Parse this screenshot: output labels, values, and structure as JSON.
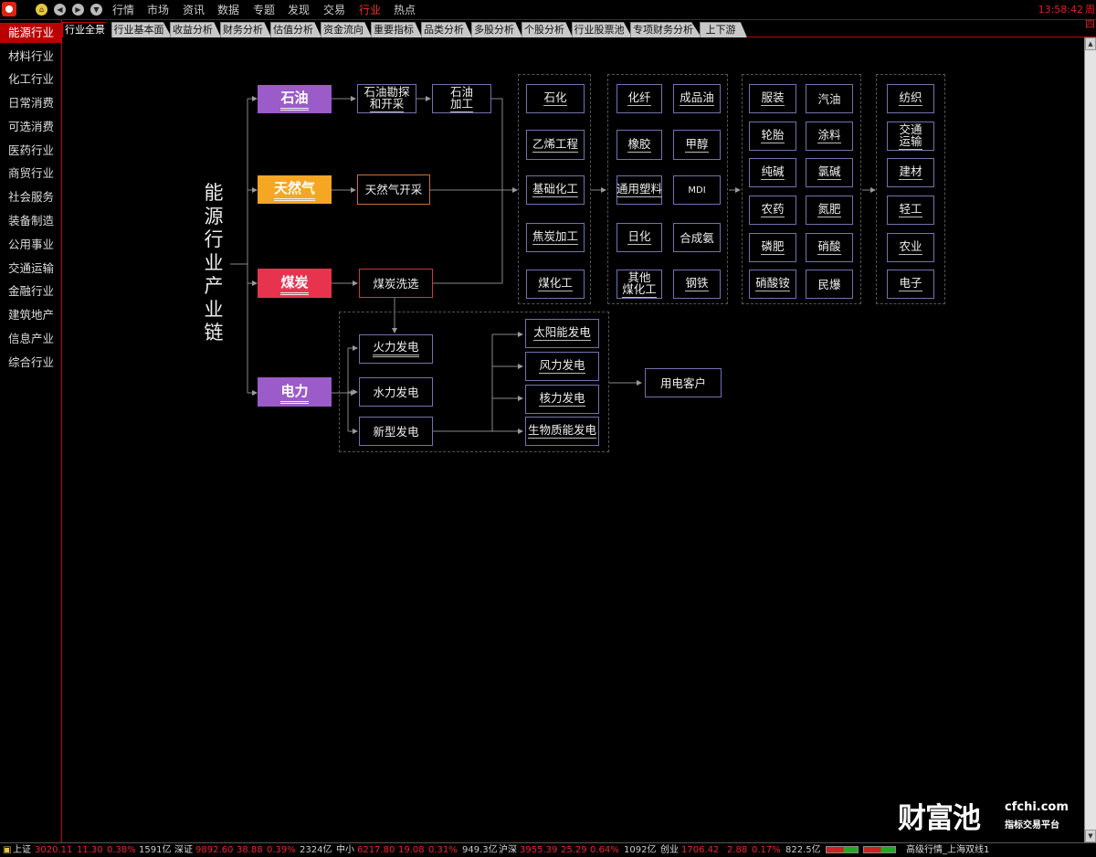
{
  "topbar": {
    "menu": [
      "行情",
      "市场",
      "资讯",
      "数据",
      "专题",
      "发现",
      "交易",
      "行业",
      "热点"
    ],
    "active_menu": "行业",
    "clock": "13:58:42",
    "clock_tail": "周四"
  },
  "tabs": [
    "行业全景",
    "行业基本面",
    "收益分析",
    "财务分析",
    "估值分析",
    "资金流向",
    "重要指标",
    "品类分析",
    "多股分析",
    "个股分析",
    "行业股票池",
    "专项财务分析",
    "上下游"
  ],
  "active_tab": "行业全景",
  "sidebar": {
    "items": [
      "能源行业",
      "材料行业",
      "化工行业",
      "日常消费",
      "可选消费",
      "医药行业",
      "商贸行业",
      "社会服务",
      "装备制造",
      "公用事业",
      "交通运输",
      "金融行业",
      "建筑地产",
      "信息产业",
      "综合行业"
    ],
    "active": "能源行业"
  },
  "diagram": {
    "title": "能源行业产业链",
    "sources": {
      "oil": "石油",
      "gas": "天然气",
      "coal": "煤炭",
      "power": "电力"
    },
    "mid": {
      "oil_explore": "石油勘探和开采",
      "oil_explore_l1": "石油勘探",
      "oil_explore_l2": "和开采",
      "oil_process_l1": "石油",
      "oil_process_l2": "加工",
      "gas_mining": "天然气开采",
      "coal_wash": "煤炭洗选"
    },
    "col1": [
      "石化",
      "乙烯工程",
      "基础化工",
      "焦炭加工",
      "煤化工"
    ],
    "col2": [
      [
        "化纤",
        "成品油"
      ],
      [
        "橡胶",
        "甲醇"
      ],
      [
        "通用塑料",
        "MDI"
      ],
      [
        "日化",
        "合成氨"
      ],
      [
        "其他煤化工",
        "钢铁"
      ]
    ],
    "col2_other_l1": "其他",
    "col2_other_l2": "煤化工",
    "col3": [
      [
        "服装",
        "汽油"
      ],
      [
        "轮胎",
        "涂料"
      ],
      [
        "纯碱",
        "氯碱"
      ],
      [
        "农药",
        "氮肥"
      ],
      [
        "磷肥",
        "硝酸"
      ],
      [
        "硝酸铵",
        "民爆"
      ]
    ],
    "col4": [
      "纺织",
      "交通运输",
      "建材",
      "轻工",
      "农业",
      "电子"
    ],
    "col4_transport_l1": "交通",
    "col4_transport_l2": "运输",
    "power_types": [
      "火力发电",
      "水力发电",
      "新型发电"
    ],
    "new_power": [
      "太阳能发电",
      "风力发电",
      "核力发电",
      "生物质能发电"
    ],
    "customer": "用电客户"
  },
  "watermark": {
    "cn": "财富池",
    "en": "cfchi.com",
    "sub": "指标交易平台"
  },
  "statusbar": {
    "items": [
      {
        "name": "上证",
        "price": "3020.11",
        "chg": "11.30",
        "pct": "0.38%",
        "vol": "1591亿"
      },
      {
        "name": "深证",
        "price": "9892.60",
        "chg": "38.88",
        "pct": "0.39%",
        "vol": "2324亿"
      },
      {
        "name": "中小",
        "price": "6217.80",
        "chg": "19.08",
        "pct": "0.31%",
        "vol": "949.3亿"
      },
      {
        "name": "沪深",
        "price": "3955.39",
        "chg": "25.29",
        "pct": "0.64%",
        "vol": "1092亿"
      },
      {
        "name": "创业",
        "price": "1706.42",
        "chg": "2.88",
        "pct": "0.17%",
        "vol": "822.5亿"
      }
    ],
    "feed": "高级行情_上海双线1"
  },
  "colors": {
    "accent_red": "#cc0000",
    "oil_header": "#9b5bc8",
    "gas_header": "#f5a623",
    "coal_header": "#e8334f",
    "power_header": "#9b5bc8",
    "node_border": "#7272b0"
  }
}
